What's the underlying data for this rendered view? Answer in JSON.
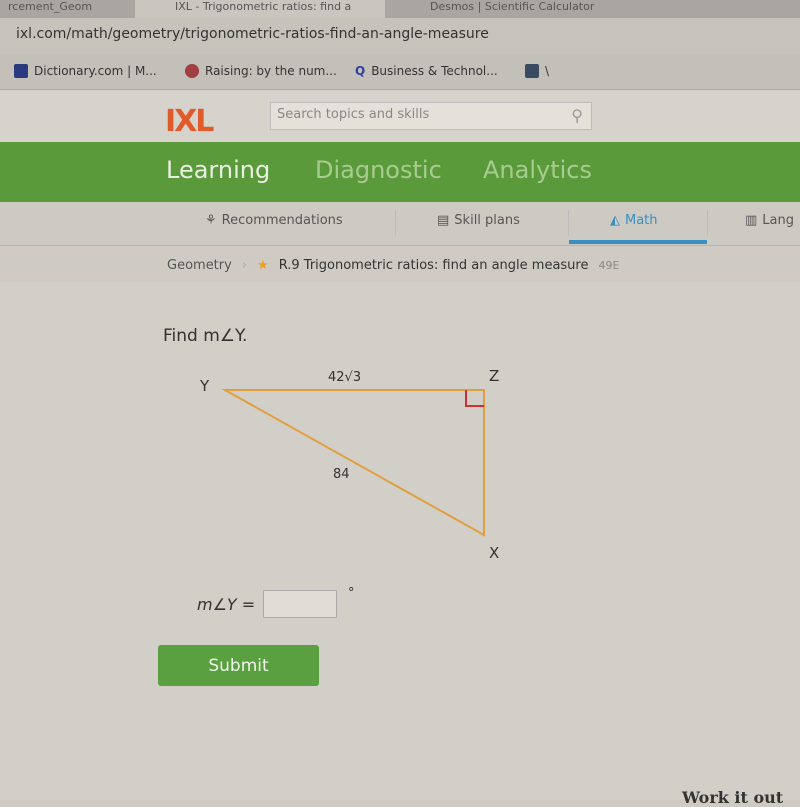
{
  "browser": {
    "tabs": [
      "rcement_Geom",
      "IXL - Trigonometric ratios: find a",
      "Desmos | Scientific Calculator"
    ],
    "url": "ixl.com/math/geometry/trigonometric-ratios-find-an-angle-measure",
    "bookmarks": [
      "Dictionary.com | M...",
      "Raising: by the num...",
      "Business & Technol...",
      "\\"
    ]
  },
  "header": {
    "logo": "IXL",
    "search_placeholder": "Search topics and skills"
  },
  "nav": {
    "items": [
      "Learning",
      "Diagnostic",
      "Analytics"
    ],
    "active": "Learning"
  },
  "subnav": {
    "items": [
      "Recommendations",
      "Skill plans",
      "Math",
      "Lang"
    ],
    "active": "Math",
    "accent": "#3a8ec0"
  },
  "breadcrumb": {
    "subject": "Geometry",
    "skill": "R.9 Trigonometric ratios: find an angle measure",
    "code": "49E"
  },
  "problem": {
    "prompt": "Find m∠Y.",
    "vertices": {
      "y": "Y",
      "z": "Z",
      "x": "X"
    },
    "side_yz": "42√3",
    "side_yx": "84",
    "answer_label": "m∠Y =",
    "answer_value": "",
    "degree": "°",
    "submit": "Submit"
  },
  "footer": {
    "work": "Work it out"
  }
}
